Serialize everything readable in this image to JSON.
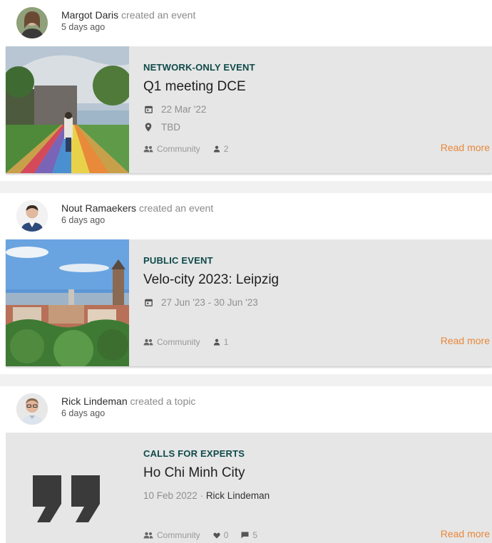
{
  "posts": [
    {
      "author": "Margot Daris",
      "action": "created an event",
      "time": "5 days ago",
      "card": {
        "eyebrow": "NETWORK-ONLY EVENT",
        "title": "Q1 meeting DCE",
        "date": "22 Mar '22",
        "location": "TBD",
        "group": "Community",
        "count": "2",
        "read_more": "Read more"
      }
    },
    {
      "author": "Nout Ramaekers",
      "action": "created an event",
      "time": "6 days ago",
      "card": {
        "eyebrow": "PUBLIC EVENT",
        "title": "Velo-city 2023: Leipzig",
        "date": "27 Jun '23 - 30 Jun '23",
        "group": "Community",
        "count": "1",
        "read_more": "Read more"
      }
    },
    {
      "author": "Rick Lindeman",
      "action": "created a topic",
      "time": "6 days ago",
      "card": {
        "eyebrow": "CALLS FOR EXPERTS",
        "title": "Ho Chi Minh City",
        "date": "10 Feb 2022 · ",
        "byline_author": "Rick Lindeman",
        "group": "Community",
        "likes": "0",
        "comments": "5",
        "read_more": "Read more"
      }
    }
  ],
  "colors": {
    "accent": "#e8873a",
    "eyebrow": "#0f4a4a",
    "card_bg": "#e6e6e6"
  }
}
